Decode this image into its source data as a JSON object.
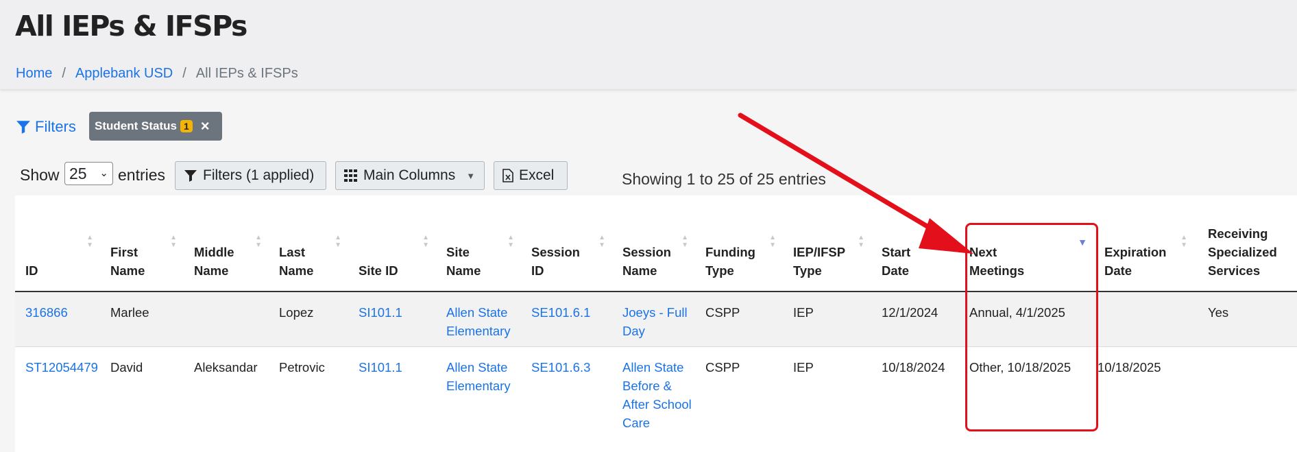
{
  "header": {
    "title": "All IEPs & IFSPs",
    "breadcrumb": [
      {
        "label": "Home"
      },
      {
        "label": "Applebank USD"
      },
      {
        "label": "All IEPs & IFSPs"
      }
    ]
  },
  "filters": {
    "link_label": "Filters",
    "chip_label": "Student Status",
    "chip_count": "1",
    "chip_close": "×"
  },
  "controls": {
    "show_label": "Show",
    "show_value": "25",
    "entries_label": "entries",
    "filters_button": "Filters (1 applied)",
    "columns_button": "Main Columns",
    "excel_button": "Excel",
    "showing_text": "Showing 1 to 25 of 25 entries"
  },
  "table": {
    "columns": [
      {
        "l1": "",
        "l2": "ID"
      },
      {
        "l1": "First",
        "l2": "Name"
      },
      {
        "l1": "Middle",
        "l2": "Name"
      },
      {
        "l1": "Last",
        "l2": "Name"
      },
      {
        "l1": "",
        "l2": "Site ID"
      },
      {
        "l1": "Site",
        "l2": "Name"
      },
      {
        "l1": "Session",
        "l2": "ID"
      },
      {
        "l1": "Session",
        "l2": "Name"
      },
      {
        "l1": "Funding",
        "l2": "Type"
      },
      {
        "l1": "IEP/IFSP",
        "l2": "Type"
      },
      {
        "l1": "Start",
        "l2": "Date"
      },
      {
        "l1": "Next",
        "l2": "Meetings"
      },
      {
        "l1": "Expiration",
        "l2": "Date"
      },
      {
        "l0": "Receiving",
        "l1": "Specialized",
        "l2": "Services"
      }
    ],
    "rows": [
      {
        "id": "316866",
        "first": "Marlee",
        "middle": "",
        "last": "Lopez",
        "site_id": "SI101.1",
        "site_name": "Allen State Elementary",
        "session_id": "SE101.6.1",
        "session_name": "Joeys - Full Day",
        "funding": "CSPP",
        "iep_type": "IEP",
        "start": "12/1/2024",
        "next_meetings": "Annual, 4/1/2025",
        "expiration": "",
        "receiving": "Yes"
      },
      {
        "id": "ST12054479",
        "first": "David",
        "middle": "Aleksandar",
        "last": "Petrovic",
        "site_id": "SI101.1",
        "site_name": "Allen State Elementary",
        "session_id": "SE101.6.3",
        "session_name": "Allen State Before & After School Care",
        "funding": "CSPP",
        "iep_type": "IEP",
        "start": "10/18/2024",
        "next_meetings": "Other, 10/18/2025",
        "expiration": "10/18/2025",
        "receiving": ""
      }
    ]
  },
  "colors": {
    "link": "#1a73e8",
    "annotation": "#e3101b",
    "chip": "#6c757d",
    "badge": "#f5b400"
  }
}
